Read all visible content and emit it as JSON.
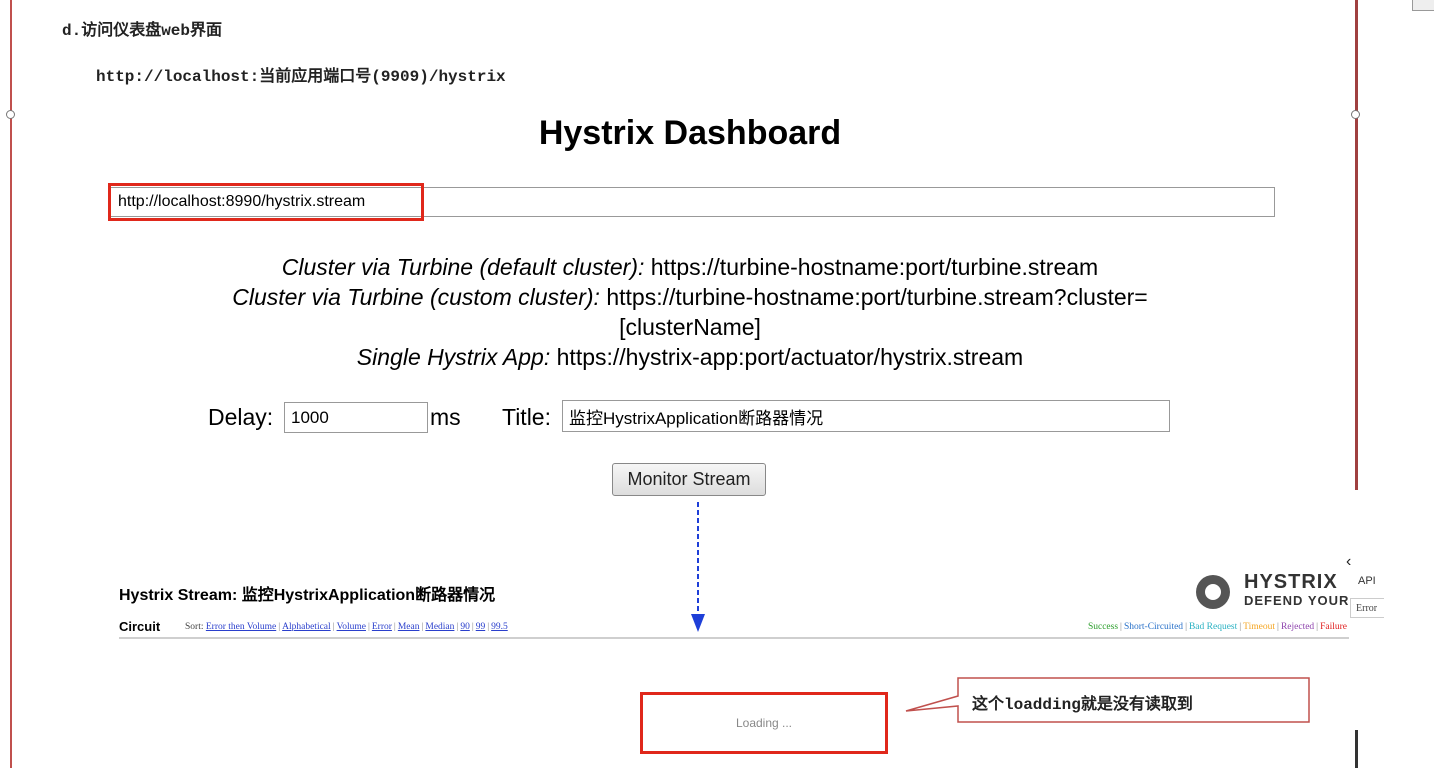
{
  "doc": {
    "heading": "d.访问仪表盘web界面",
    "url_hint": "http://localhost:当前应用端口号(9909)/hystrix"
  },
  "dashboard": {
    "title": "Hystrix Dashboard",
    "stream_url_value": "http://localhost:8990/hystrix.stream",
    "examples": [
      {
        "label": "Cluster via Turbine (default cluster):",
        "value": "https://turbine-hostname:port/turbine.stream"
      },
      {
        "label": "Cluster via Turbine (custom cluster):",
        "value": "https://turbine-hostname:port/turbine.stream?cluster=[clusterName]"
      },
      {
        "label": "Single Hystrix App:",
        "value": "https://hystrix-app:port/actuator/hystrix.stream"
      }
    ],
    "delay_label": "Delay:",
    "delay_value": "1000",
    "ms_label": "ms",
    "title_label": "Title:",
    "title_value": "监控HystrixApplication断路器情况",
    "monitor_button": "Monitor Stream"
  },
  "stream": {
    "title": "Hystrix Stream: 监控HystrixApplication断路器情况",
    "circuit_label": "Circuit",
    "sort_label": "Sort:",
    "sort_options": [
      "Error then Volume",
      "Alphabetical",
      "Volume",
      "Error",
      "Mean",
      "Median",
      "90",
      "99",
      "99.5"
    ],
    "legend": [
      {
        "label": "Success",
        "color": "#2c9e2c"
      },
      {
        "label": "Short-Circuited",
        "color": "#2a72c9"
      },
      {
        "label": "Bad Request",
        "color": "#2ab1c2"
      },
      {
        "label": "Timeout",
        "color": "#f5a623"
      },
      {
        "label": "Rejected",
        "color": "#8e44ad"
      },
      {
        "label": "Failure",
        "color": "#e02020"
      }
    ],
    "logo_big": "HYSTRIX",
    "logo_small": "DEFEND YOUR APP",
    "api_text": "API",
    "error_col": "Error",
    "loading": "Loading ..."
  },
  "annotation": {
    "callout": "这个loadding就是没有读取到",
    "highlight_color": "#e0281b",
    "arrow_color": "#1e3fd8"
  }
}
